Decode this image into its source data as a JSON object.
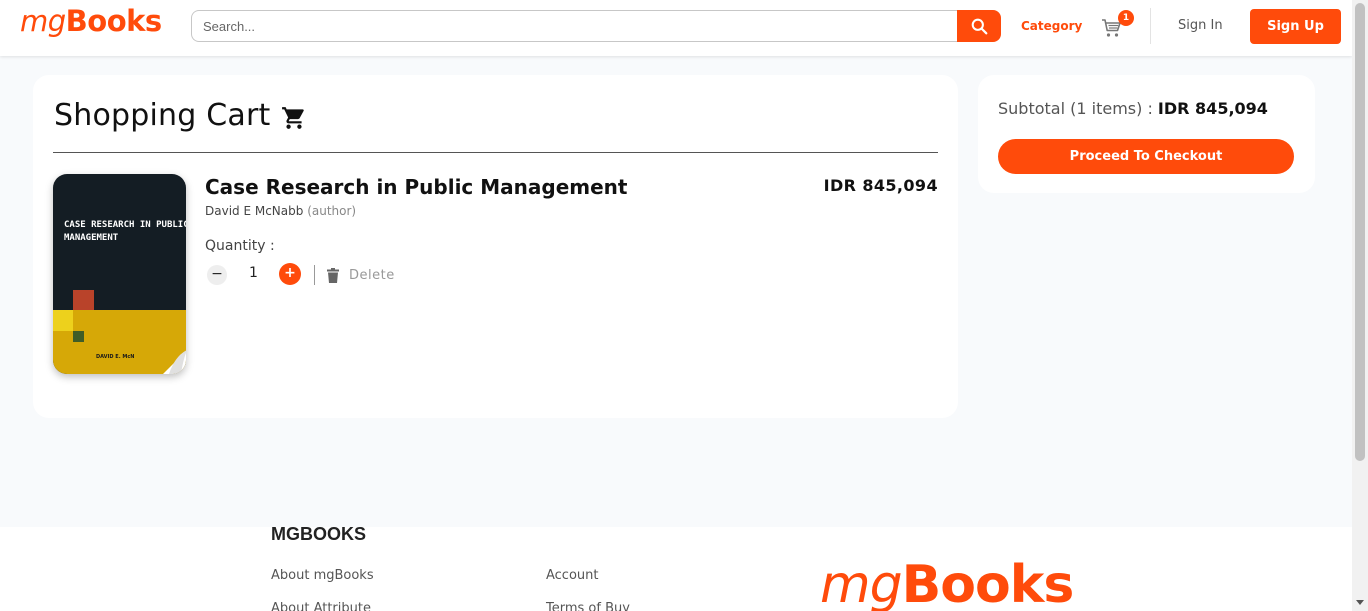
{
  "header": {
    "logo_light": "mg",
    "logo_bold": "Books",
    "search_placeholder": "Search...",
    "search_icon": "search-icon",
    "category_label": "Category",
    "cart_count": "1",
    "signin_label": "Sign In",
    "signup_label": "Sign Up"
  },
  "cart": {
    "title": "Shopping Cart",
    "title_icon": "cart-icon",
    "items": [
      {
        "title": "Case Research in Public Management",
        "author": "David E McNabb",
        "author_role": "(author)",
        "price": "IDR 845,094",
        "quantity_label": "Quantity :",
        "quantity": "1",
        "delete_label": "Delete",
        "cover_title": "CASE RESEARCH IN PUBLIC MANAGEMENT",
        "cover_author": "DAVID E. McN"
      }
    ]
  },
  "summary": {
    "subtotal_label": "Subtotal (1 items) : ",
    "subtotal_amount": "IDR 845,094",
    "checkout_label": "Proceed To Checkout"
  },
  "footer": {
    "heading": "MGBOOKS",
    "links_col1": [
      "About mgBooks",
      "About Attribute"
    ],
    "links_col2": [
      "Account",
      "Terms of Buy"
    ],
    "logo_light": "mg",
    "logo_bold": "Books"
  },
  "colors": {
    "accent": "#ff4b0b",
    "background": "#f8fafc"
  }
}
